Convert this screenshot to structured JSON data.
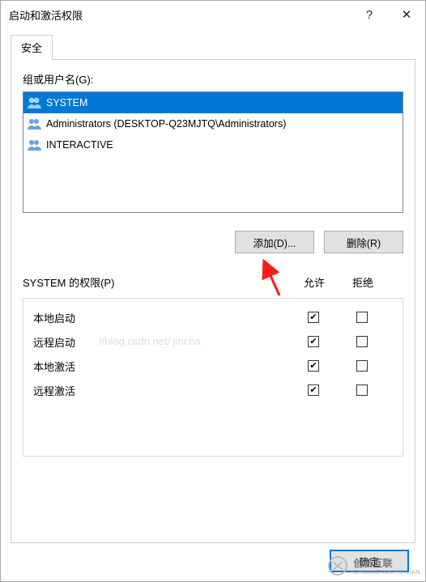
{
  "window": {
    "title": "启动和激活权限",
    "help_glyph": "?",
    "close_glyph": "✕"
  },
  "tabs": {
    "security": "安全"
  },
  "users": {
    "label": "组或用户名(G):",
    "items": [
      {
        "name": "SYSTEM",
        "selected": true
      },
      {
        "name": "Administrators (DESKTOP-Q23MJTQ\\Administrators)",
        "selected": false
      },
      {
        "name": "INTERACTIVE",
        "selected": false
      }
    ],
    "add_btn": "添加(D)...",
    "remove_btn": "删除(R)"
  },
  "permissions": {
    "label": "SYSTEM 的权限(P)",
    "col_allow": "允许",
    "col_deny": "拒绝",
    "rows": [
      {
        "name": "本地启动",
        "allow": true,
        "deny": false
      },
      {
        "name": "远程启动",
        "allow": true,
        "deny": false
      },
      {
        "name": "本地激活",
        "allow": true,
        "deny": false
      },
      {
        "name": "远程激活",
        "allow": true,
        "deny": false
      }
    ]
  },
  "buttons": {
    "ok": "确定"
  },
  "watermark": "//blog.csdn.net/    jincha",
  "footer_brand": "创新互联",
  "footer_sub": "CHUANG XIN HU LIAN"
}
